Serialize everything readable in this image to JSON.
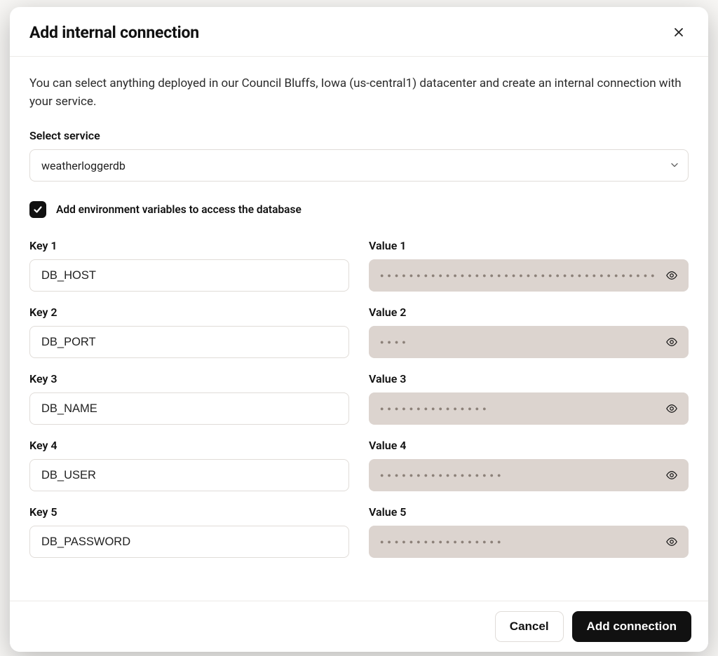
{
  "modal": {
    "title": "Add internal connection",
    "intro": "You can select anything deployed in our Council Bluffs, Iowa (us-central1) datacenter and create an internal connection with your service.",
    "select_label": "Select service",
    "select_value": "weatherloggerdb",
    "checkbox_label": "Add environment variables to access the database",
    "checkbox_checked": true,
    "pairs": [
      {
        "key_label": "Key 1",
        "key_value": "DB_HOST",
        "value_label": "Value 1",
        "masked_len": 40
      },
      {
        "key_label": "Key 2",
        "key_value": "DB_PORT",
        "value_label": "Value 2",
        "masked_len": 4
      },
      {
        "key_label": "Key 3",
        "key_value": "DB_NAME",
        "value_label": "Value 3",
        "masked_len": 15
      },
      {
        "key_label": "Key 4",
        "key_value": "DB_USER",
        "value_label": "Value 4",
        "masked_len": 17
      },
      {
        "key_label": "Key 5",
        "key_value": "DB_PASSWORD",
        "value_label": "Value 5",
        "masked_len": 17
      }
    ],
    "cancel_label": "Cancel",
    "submit_label": "Add connection"
  }
}
